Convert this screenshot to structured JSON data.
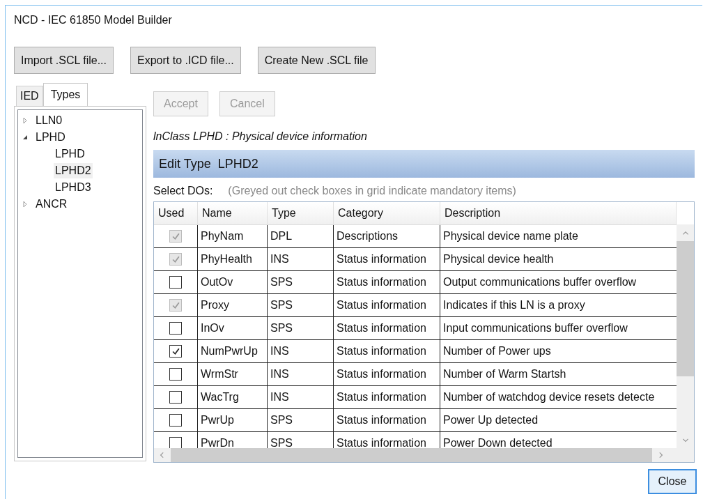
{
  "window": {
    "title": "NCD - IEC 61850 Model Builder"
  },
  "toolbar": [
    "Import .SCL file...",
    "Export to .ICD file...",
    "Create New .SCL file"
  ],
  "tabs": [
    {
      "label": "IED",
      "selected": false
    },
    {
      "label": "Types",
      "selected": true
    }
  ],
  "tree": [
    {
      "label": "LLN0",
      "expanded": false,
      "selected": false
    },
    {
      "label": "LPHD",
      "expanded": true,
      "selected": false,
      "children": [
        {
          "label": "LPHD",
          "selected": false
        },
        {
          "label": "LPHD2",
          "selected": true
        },
        {
          "label": "LPHD3",
          "selected": false
        }
      ]
    },
    {
      "label": "ANCR",
      "expanded": false,
      "selected": false
    }
  ],
  "actions": [
    {
      "label": "Accept",
      "disabled": true
    },
    {
      "label": "Cancel",
      "disabled": true
    }
  ],
  "lnclass": "lnClass LPHD :  Physical device information",
  "edit_type": {
    "label": "Edit Type",
    "value": "LPHD2"
  },
  "select_label": "Select DOs:",
  "select_hint": "(Greyed out check boxes in grid indicate mandatory items)",
  "grid": {
    "columns": [
      "Used",
      "Name",
      "Type",
      "Category",
      "Description"
    ],
    "rows": [
      {
        "checked": true,
        "disabled": true,
        "name": "PhyNam",
        "type": "DPL",
        "category": "Descriptions",
        "description": "Physical device name plate"
      },
      {
        "checked": true,
        "disabled": true,
        "name": "PhyHealth",
        "type": "INS",
        "category": "Status information",
        "description": "Physical device health"
      },
      {
        "checked": false,
        "disabled": false,
        "name": "OutOv",
        "type": "SPS",
        "category": "Status information",
        "description": "Output communications buffer overflow"
      },
      {
        "checked": true,
        "disabled": true,
        "name": "Proxy",
        "type": "SPS",
        "category": "Status information",
        "description": "Indicates if this LN is a proxy"
      },
      {
        "checked": false,
        "disabled": false,
        "name": "InOv",
        "type": "SPS",
        "category": "Status information",
        "description": "Input communications buffer overflow"
      },
      {
        "checked": true,
        "disabled": false,
        "name": "NumPwrUp",
        "type": "INS",
        "category": "Status information",
        "description": "Number of Power ups"
      },
      {
        "checked": false,
        "disabled": false,
        "name": "WrmStr",
        "type": "INS",
        "category": "Status information",
        "description": "Number of Warm Startsh"
      },
      {
        "checked": false,
        "disabled": false,
        "name": "WacTrg",
        "type": "INS",
        "category": "Status information",
        "description": "Number of watchdog device resets detecte"
      },
      {
        "checked": false,
        "disabled": false,
        "name": "PwrUp",
        "type": "SPS",
        "category": "Status information",
        "description": "Power Up detected"
      },
      {
        "checked": false,
        "disabled": false,
        "name": "PwrDn",
        "type": "SPS",
        "category": "Status information",
        "description": "Power Down detected"
      }
    ]
  },
  "close": "Close"
}
